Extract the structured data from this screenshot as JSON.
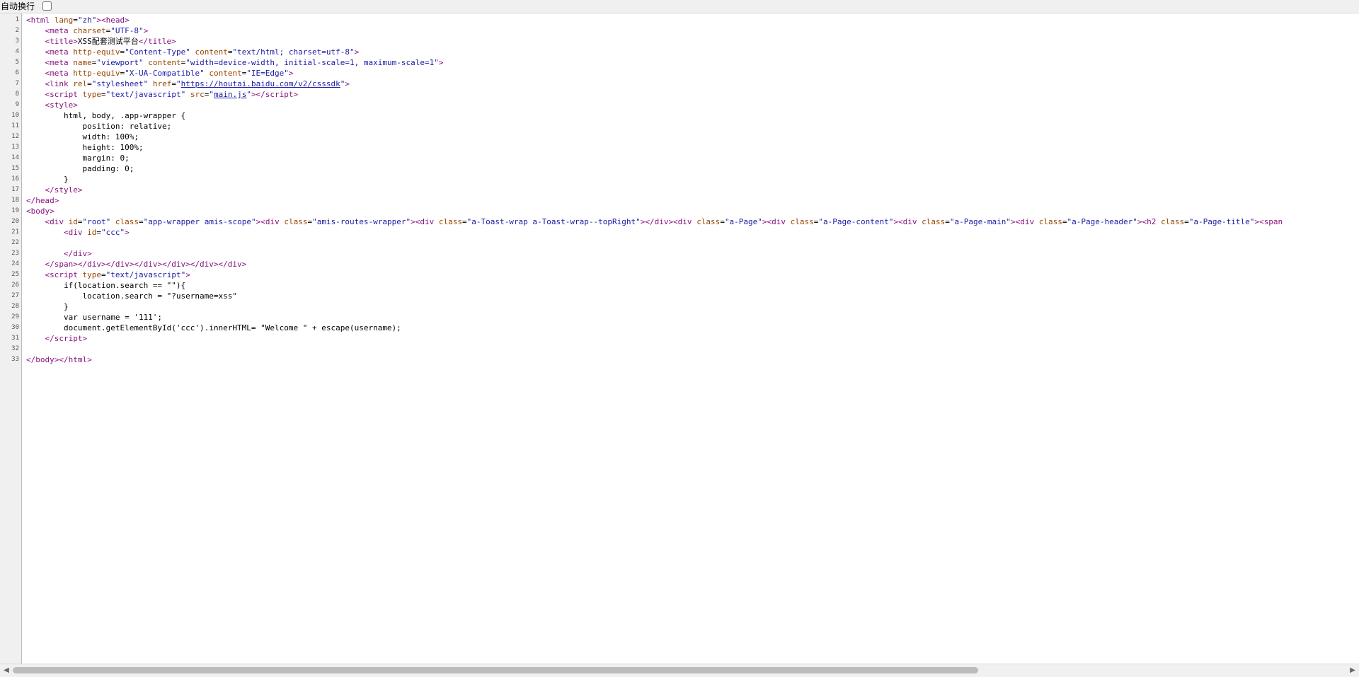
{
  "toolbar": {
    "wrap_label": "自动换行",
    "wrap_checked": false
  },
  "source": {
    "lines": [
      {
        "n": "1",
        "html": "<span class='t'>&lt;html</span> <span class='a'>lang</span>=<span class='v'>\"zh\"</span><span class='t'>&gt;&lt;head&gt;</span>"
      },
      {
        "n": "2",
        "html": "    <span class='t'>&lt;meta</span> <span class='a'>charset</span>=<span class='v'>\"UTF-8\"</span><span class='t'>&gt;</span>"
      },
      {
        "n": "3",
        "html": "    <span class='t'>&lt;title&gt;</span>XSS配套测试平台<span class='t'>&lt;/title&gt;</span>"
      },
      {
        "n": "4",
        "html": "    <span class='t'>&lt;meta</span> <span class='a'>http-equiv</span>=<span class='v'>\"Content-Type\"</span> <span class='a'>content</span>=<span class='v'>\"text/html; charset=utf-8\"</span><span class='t'>&gt;</span>"
      },
      {
        "n": "5",
        "html": "    <span class='t'>&lt;meta</span> <span class='a'>name</span>=<span class='v'>\"viewport\"</span> <span class='a'>content</span>=<span class='v'>\"width=device-width, initial-scale=1, maximum-scale=1\"</span><span class='t'>&gt;</span>"
      },
      {
        "n": "6",
        "html": "    <span class='t'>&lt;meta</span> <span class='a'>http-equiv</span>=<span class='v'>\"X-UA-Compatible\"</span> <span class='a'>content</span>=<span class='v'>\"IE=Edge\"</span><span class='t'>&gt;</span>"
      },
      {
        "n": "7",
        "html": "    <span class='t'>&lt;link</span> <span class='a'>rel</span>=<span class='v'>\"stylesheet\"</span> <span class='a'>href</span>=<span class='v'>\"</span><span class='lk'>https://houtai.baidu.com/v2/csssdk</span><span class='v'>\"</span><span class='t'>&gt;</span>"
      },
      {
        "n": "8",
        "html": "    <span class='t'>&lt;script</span> <span class='a'>type</span>=<span class='v'>\"text/javascript\"</span> <span class='a'>src</span>=<span class='v'>\"</span><span class='lk'>main.js</span><span class='v'>\"</span><span class='t'>&gt;&lt;/script&gt;</span>"
      },
      {
        "n": "9",
        "html": "    <span class='t'>&lt;style&gt;</span>"
      },
      {
        "n": "10",
        "html": "        html, body, .app-wrapper {"
      },
      {
        "n": "11",
        "html": "            position: relative;"
      },
      {
        "n": "12",
        "html": "            width: 100%;"
      },
      {
        "n": "13",
        "html": "            height: 100%;"
      },
      {
        "n": "14",
        "html": "            margin: 0;"
      },
      {
        "n": "15",
        "html": "            padding: 0;"
      },
      {
        "n": "16",
        "html": "        }"
      },
      {
        "n": "17",
        "html": "    <span class='t'>&lt;/style&gt;</span>"
      },
      {
        "n": "18",
        "html": "<span class='t'>&lt;/head&gt;</span>"
      },
      {
        "n": "19",
        "html": "<span class='t'>&lt;body&gt;</span>"
      },
      {
        "n": "20",
        "html": "    <span class='t'>&lt;div</span> <span class='a'>id</span>=<span class='v'>\"root\"</span> <span class='a'>class</span>=<span class='v'>\"app-wrapper amis-scope\"</span><span class='t'>&gt;&lt;div</span> <span class='a'>class</span>=<span class='v'>\"amis-routes-wrapper\"</span><span class='t'>&gt;&lt;div</span> <span class='a'>class</span>=<span class='v'>\"a-Toast-wrap a-Toast-wrap--topRight\"</span><span class='t'>&gt;&lt;/div&gt;&lt;div</span> <span class='a'>class</span>=<span class='v'>\"a-Page\"</span><span class='t'>&gt;&lt;div</span> <span class='a'>class</span>=<span class='v'>\"a-Page-content\"</span><span class='t'>&gt;&lt;div</span> <span class='a'>class</span>=<span class='v'>\"a-Page-main\"</span><span class='t'>&gt;&lt;div</span> <span class='a'>class</span>=<span class='v'>\"a-Page-header\"</span><span class='t'>&gt;&lt;h2</span> <span class='a'>class</span>=<span class='v'>\"a-Page-title\"</span><span class='t'>&gt;&lt;span</span>"
      },
      {
        "n": "21",
        "html": "        <span class='t'>&lt;div</span> <span class='a'>id</span>=<span class='v'>\"ccc\"</span><span class='t'>&gt;</span>"
      },
      {
        "n": "22",
        "html": ""
      },
      {
        "n": "23",
        "html": "        <span class='t'>&lt;/div&gt;</span>"
      },
      {
        "n": "24",
        "html": "    <span class='t'>&lt;/span&gt;&lt;/div&gt;&lt;/div&gt;&lt;/div&gt;&lt;/div&gt;&lt;/div&gt;&lt;/div&gt;</span>"
      },
      {
        "n": "25",
        "html": "    <span class='t'>&lt;script</span> <span class='a'>type</span>=<span class='v'>\"text/javascript\"</span><span class='t'>&gt;</span>"
      },
      {
        "n": "26",
        "html": "        if(location.search == \"\"){"
      },
      {
        "n": "27",
        "html": "            location.search = \"?username=xss\""
      },
      {
        "n": "28",
        "html": "        }"
      },
      {
        "n": "29",
        "html": "        var username = '111';"
      },
      {
        "n": "30",
        "html": "        document.getElementById('ccc').innerHTML= \"Welcome \" + escape(username);"
      },
      {
        "n": "31",
        "html": "    <span class='t'>&lt;/script&gt;</span>"
      },
      {
        "n": "32",
        "html": ""
      },
      {
        "n": "33",
        "html": "<span class='t'>&lt;/body&gt;&lt;/html&gt;</span>"
      }
    ]
  },
  "scrollbar": {
    "left_arrow_icon": "chevron-left-icon",
    "right_arrow_icon": "chevron-right-icon",
    "left_arrow_glyph": "◀",
    "right_arrow_glyph": "▶"
  }
}
